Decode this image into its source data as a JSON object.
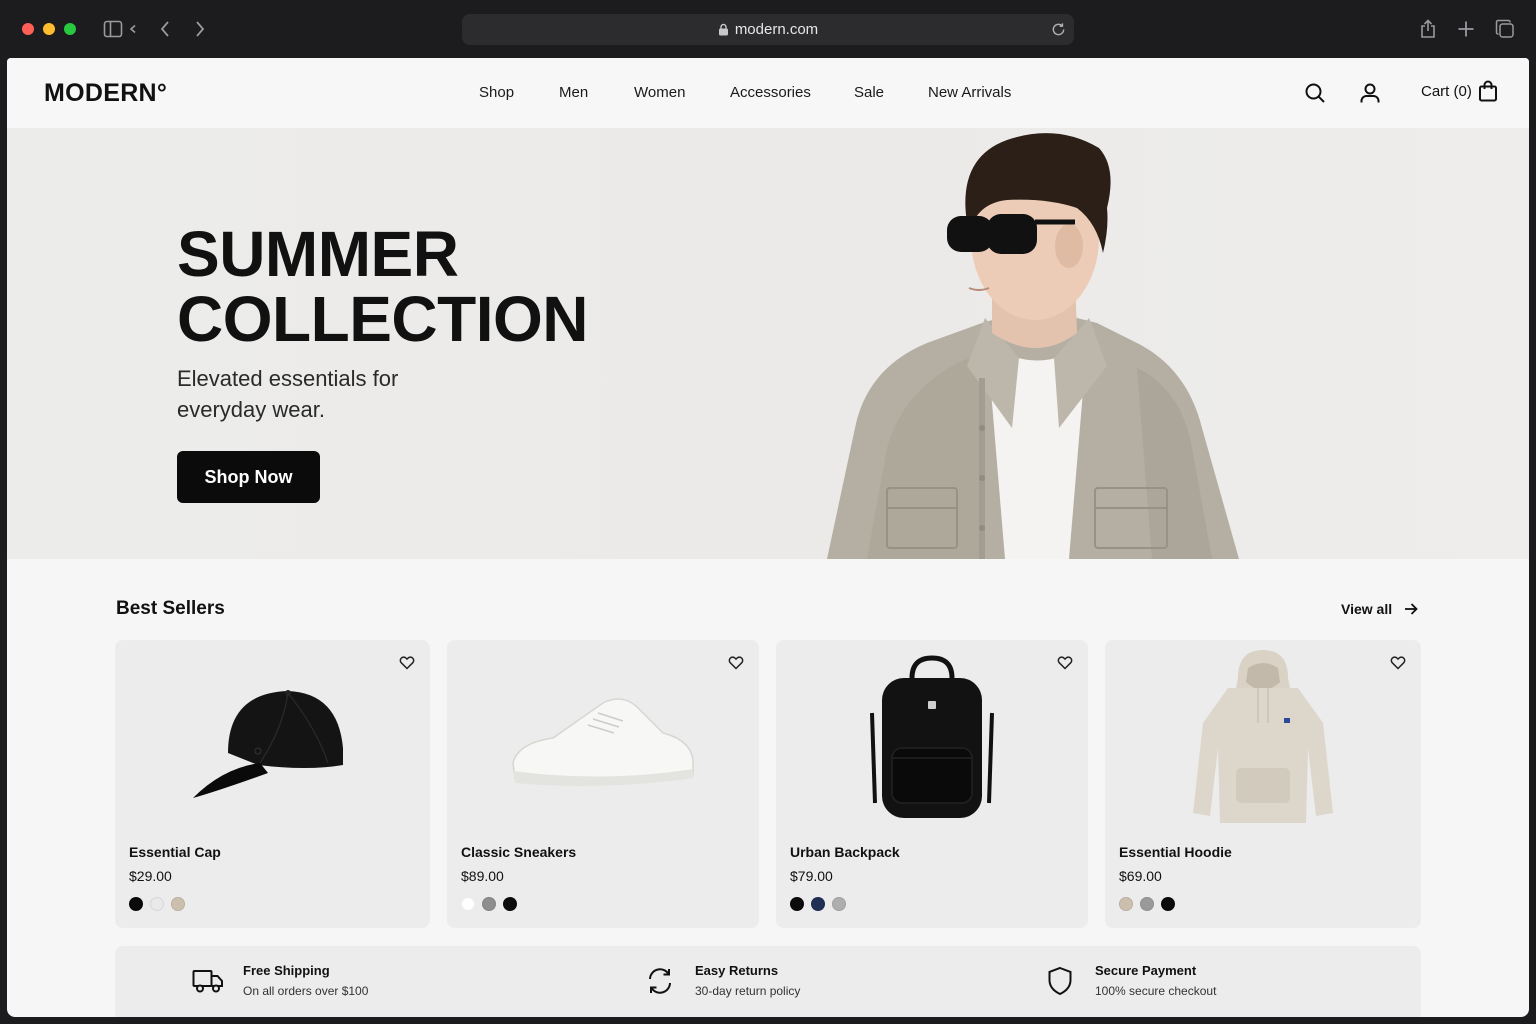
{
  "browser": {
    "url": "modern.com"
  },
  "header": {
    "logo": "MODERN°",
    "nav": [
      "Shop",
      "Men",
      "Women",
      "Accessories",
      "Sale",
      "New Arrivals"
    ],
    "cart_label": "Cart (0)"
  },
  "hero": {
    "title_line1": "SUMMER",
    "title_line2": "COLLECTION",
    "subtitle": "Elevated essentials for everyday wear.",
    "cta": "Shop Now"
  },
  "best_sellers": {
    "title": "Best Sellers",
    "view_all": "View all",
    "products": [
      {
        "name": "Essential Cap",
        "price": "$29.00",
        "image": "black-baseball-cap",
        "swatches": [
          "#0b0b0b",
          "#e9e9e9",
          "#cbbfae"
        ]
      },
      {
        "name": "Classic Sneakers",
        "price": "$89.00",
        "image": "white-sneaker",
        "swatches": [
          "#ffffff",
          "#8e8e8e",
          "#0b0b0b"
        ]
      },
      {
        "name": "Urban Backpack",
        "price": "$79.00",
        "image": "black-backpack",
        "swatches": [
          "#0b0b0b",
          "#1f2f55",
          "#aeaeae"
        ]
      },
      {
        "name": "Essential Hoodie",
        "price": "$69.00",
        "image": "beige-hoodie",
        "swatches": [
          "#cbbfae",
          "#9a9a9a",
          "#0b0b0b"
        ]
      }
    ]
  },
  "features": [
    {
      "icon": "truck-icon",
      "title": "Free Shipping",
      "subtitle": "On all orders over $100"
    },
    {
      "icon": "refresh-icon",
      "title": "Easy Returns",
      "subtitle": "30-day return policy"
    },
    {
      "icon": "shield-icon",
      "title": "Secure Payment",
      "subtitle": "100% secure checkout"
    }
  ],
  "colors": {
    "primary": "#0b0b0b",
    "page_background": "#f6f6f6",
    "card_background": "#ececec",
    "hero_background": "#ebeae8"
  }
}
